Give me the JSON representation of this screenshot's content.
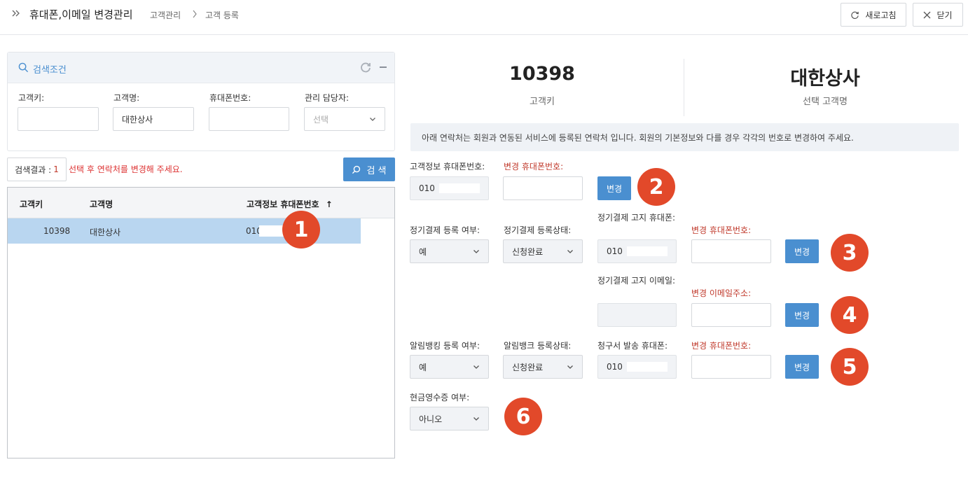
{
  "header": {
    "title": "휴대폰,이메일 변경관리",
    "breadcrumb": [
      "고객관리",
      "고객 등록"
    ],
    "refresh_label": "새로고침",
    "close_label": "닫기"
  },
  "search_panel": {
    "title": "검색조건",
    "fields": {
      "customer_key": {
        "label": "고객키:",
        "value": ""
      },
      "customer_name": {
        "label": "고객명:",
        "value": "대한상사"
      },
      "phone": {
        "label": "휴대폰번호:",
        "value": ""
      },
      "manager": {
        "label": "관리 담당자:",
        "value": "선택"
      }
    },
    "result_label": "검색결과 :",
    "result_count": "1",
    "hint": "선택 후 연락처를 변경해 주세요.",
    "search_button": "검 색"
  },
  "table": {
    "columns": [
      "고객키",
      "고객명",
      "고객정보 휴대폰번호"
    ],
    "sort_indicator": "↑",
    "rows": [
      {
        "key": "10398",
        "name": "대한상사",
        "phone": "010"
      }
    ]
  },
  "summary": {
    "customer_key": "10398",
    "customer_key_label": "고객키",
    "customer_name": "대한상사",
    "customer_name_label": "선택 고객명"
  },
  "notice": "아래 연락처는 회원과 연동된 서비스에 등록된 연락처 입니다. 회원의 기본정보와 다를 경우 각각의 번호로 변경하여 주세요.",
  "form": {
    "row1": {
      "phone_label": "고객정보 휴대폰번호:",
      "phone_value": "010",
      "change_label": "변경 휴대폰번호:",
      "change_value": "",
      "button": "변경",
      "badge": "2"
    },
    "row2": {
      "reg_label": "정기결제 등록 여부:",
      "reg_value": "예",
      "status_label": "정기결제 등록상태:",
      "status_value": "신청완료",
      "notify_label": "정기결제 고지 휴대폰:",
      "notify_value": "010",
      "change_label": "변경 휴대폰번호:",
      "change_value": "",
      "button": "변경",
      "badge": "3"
    },
    "row3": {
      "email_label": "정기결제 고지 이메일:",
      "email_value": "",
      "change_label": "변경 이메일주소:",
      "change_value": "",
      "button": "변경",
      "badge": "4"
    },
    "row4": {
      "reg_label": "알림뱅킹 등록 여부:",
      "reg_value": "예",
      "status_label": "알림뱅크 등록상태:",
      "status_value": "신청완료",
      "bill_label": "청구서 발송 휴대폰:",
      "bill_value": "010",
      "change_label": "변경 휴대폰번호:",
      "change_value": "",
      "button": "변경",
      "badge": "5"
    },
    "row5": {
      "cash_label": "현금영수증 여부:",
      "cash_value": "아니오",
      "badge": "6"
    }
  },
  "table_badge": "1",
  "colors": {
    "accent": "#4a8fd0",
    "badge": "#e2492a",
    "selected_row": "#b9d6f0",
    "warning_text": "#c0392b"
  }
}
